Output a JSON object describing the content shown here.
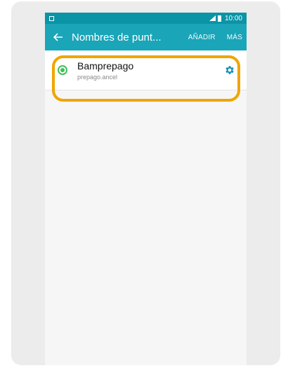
{
  "status_bar": {
    "time": "10:00",
    "icons": [
      "image-icon",
      "signal-icon",
      "battery-icon"
    ]
  },
  "app_bar": {
    "title": "Nombres de punt...",
    "actions": [
      "AÑADIR",
      "MÁS"
    ],
    "back_icon": "arrow-left-icon",
    "color": "#1aa5b8"
  },
  "apn_list": {
    "items": [
      {
        "name": "Bamprepago",
        "apn": "prepago.ancel",
        "selected": true,
        "radio_color": "#3fbf5a",
        "settings_icon": "gear-icon"
      }
    ]
  },
  "highlight_color": "#f0a500"
}
